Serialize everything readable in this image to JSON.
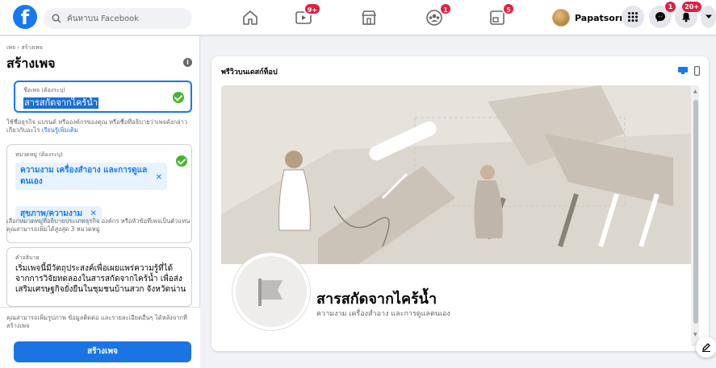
{
  "search": {
    "placeholder": "ค้นหาบน Facebook"
  },
  "nav": {
    "home": {
      "icon": "home-icon"
    },
    "watch": {
      "icon": "video-icon",
      "badge": "9+"
    },
    "marketplace": {
      "icon": "marketplace-icon"
    },
    "groups": {
      "icon": "groups-icon",
      "badge": "1"
    },
    "gaming": {
      "icon": "gaming-icon",
      "badge": "5"
    }
  },
  "profile": {
    "name": "Papatsorn"
  },
  "actions": {
    "menu": {
      "icon": "grid-menu-icon"
    },
    "messenger": {
      "icon": "messenger-icon",
      "badge": "1"
    },
    "notifications": {
      "icon": "bell-icon",
      "badge": "20+"
    },
    "account": {
      "icon": "chevron-down-icon"
    }
  },
  "left": {
    "breadcrumb": "เพจ › สร้างเพจ",
    "title": "สร้างเพจ",
    "name_field": {
      "label": "ชื่อเพจ (ต้องระบุ)",
      "value": "สารสกัดจากไคร้น้ำ"
    },
    "name_help": "ใช้ชื่อธุรกิจ แบรนด์ หรือองค์กรของคุณ หรือชื่อที่อธิบายว่าเพจดังกล่าวเกี่ยวกับอะไร",
    "name_help_link": "เรียนรู้เพิ่มเติม",
    "category_field": {
      "label": "หมวดหมู่ (ต้องระบุ)",
      "chips": [
        {
          "label": "ความงาม เครื่องสำอาง และการดูแลตนเอง"
        },
        {
          "label": "สุขภาพ/ความงาม"
        }
      ]
    },
    "category_help": "เลือกหมวดหมู่ที่อธิบายประเภทธุรกิจ องค์กร หรือหัวข้อที่เพจเป็นตัวแทน คุณสามารถเพิ่มได้สูงสุด 3 หมวดหมู่",
    "description_field": {
      "label": "คำอธิบาย",
      "value": "เริ่มเพจนี้มีวัตถุประสงค์เพื่อเผยแพร่ความรู้ที่ได้จากการวิจัยทดลองในสารสกัดจากไคร้น้ำ เพื่อส่งเสริมเศรษฐกิจยั่งยืนในชุมชนบ้านสวก จังหวัดน่าน"
    },
    "footer_help": "คุณสามารถเพิ่มรูปภาพ ข้อมูลติดต่อ และรายละเอียดอื่นๆ ได้หลังจากที่สร้างเพจ",
    "create_button": "สร้างเพจ"
  },
  "preview": {
    "title": "พรีวิวบนเดสก์ท็อป",
    "page_name": "สารสกัดจากไคร้น้ำ",
    "page_category": "ความงาม เครื่องสำอาง และการดูแลตนเอง"
  },
  "colors": {
    "brand": "#1877f2",
    "badge": "#e41e3f",
    "success": "#42b72a"
  }
}
